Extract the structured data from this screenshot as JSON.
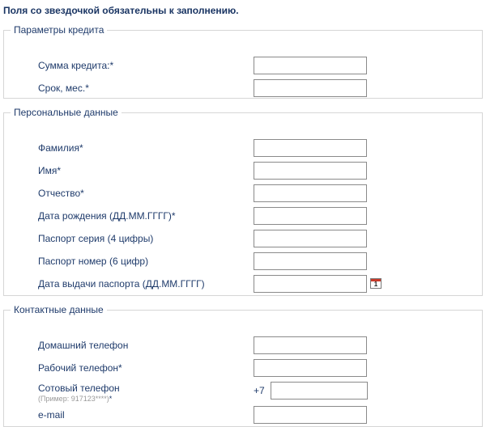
{
  "note": "Поля со звездочкой обязательны к заполнению.",
  "sections": [
    {
      "legend": "Параметры кредита",
      "fields": [
        {
          "label": "Сумма кредита:*",
          "value": ""
        },
        {
          "label": "Срок, мес.*",
          "value": ""
        }
      ]
    },
    {
      "legend": "Персональные данные",
      "fields": [
        {
          "label": "Фамилия*",
          "value": ""
        },
        {
          "label": "Имя*",
          "value": ""
        },
        {
          "label": "Отчество*",
          "value": ""
        },
        {
          "label": "Дата рождения (ДД.ММ.ГГГГ)*",
          "value": ""
        },
        {
          "label": "Паспорт серия (4 цифры)",
          "value": ""
        },
        {
          "label": "Паспорт номер (6 цифр)",
          "value": ""
        },
        {
          "label": "Дата выдачи паспорта (ДД.ММ.ГГГГ)",
          "value": ""
        }
      ],
      "calendar_icon_text": "1"
    },
    {
      "legend": "Контактные данные",
      "fields": [
        {
          "label": "Домашний телефон",
          "value": ""
        },
        {
          "label": "Рабочий телефон*",
          "value": ""
        },
        {
          "label": "Сотовый телефон",
          "hint": "(Пример: 917123****)",
          "star": "*",
          "prefix": "+7",
          "value": ""
        },
        {
          "label": "e-mail",
          "value": ""
        }
      ]
    }
  ],
  "colors": {
    "text": "#1f3b6b",
    "border": "#d6d6d6",
    "input_border": "#8a8a8a",
    "hint": "#9a9a9a"
  }
}
